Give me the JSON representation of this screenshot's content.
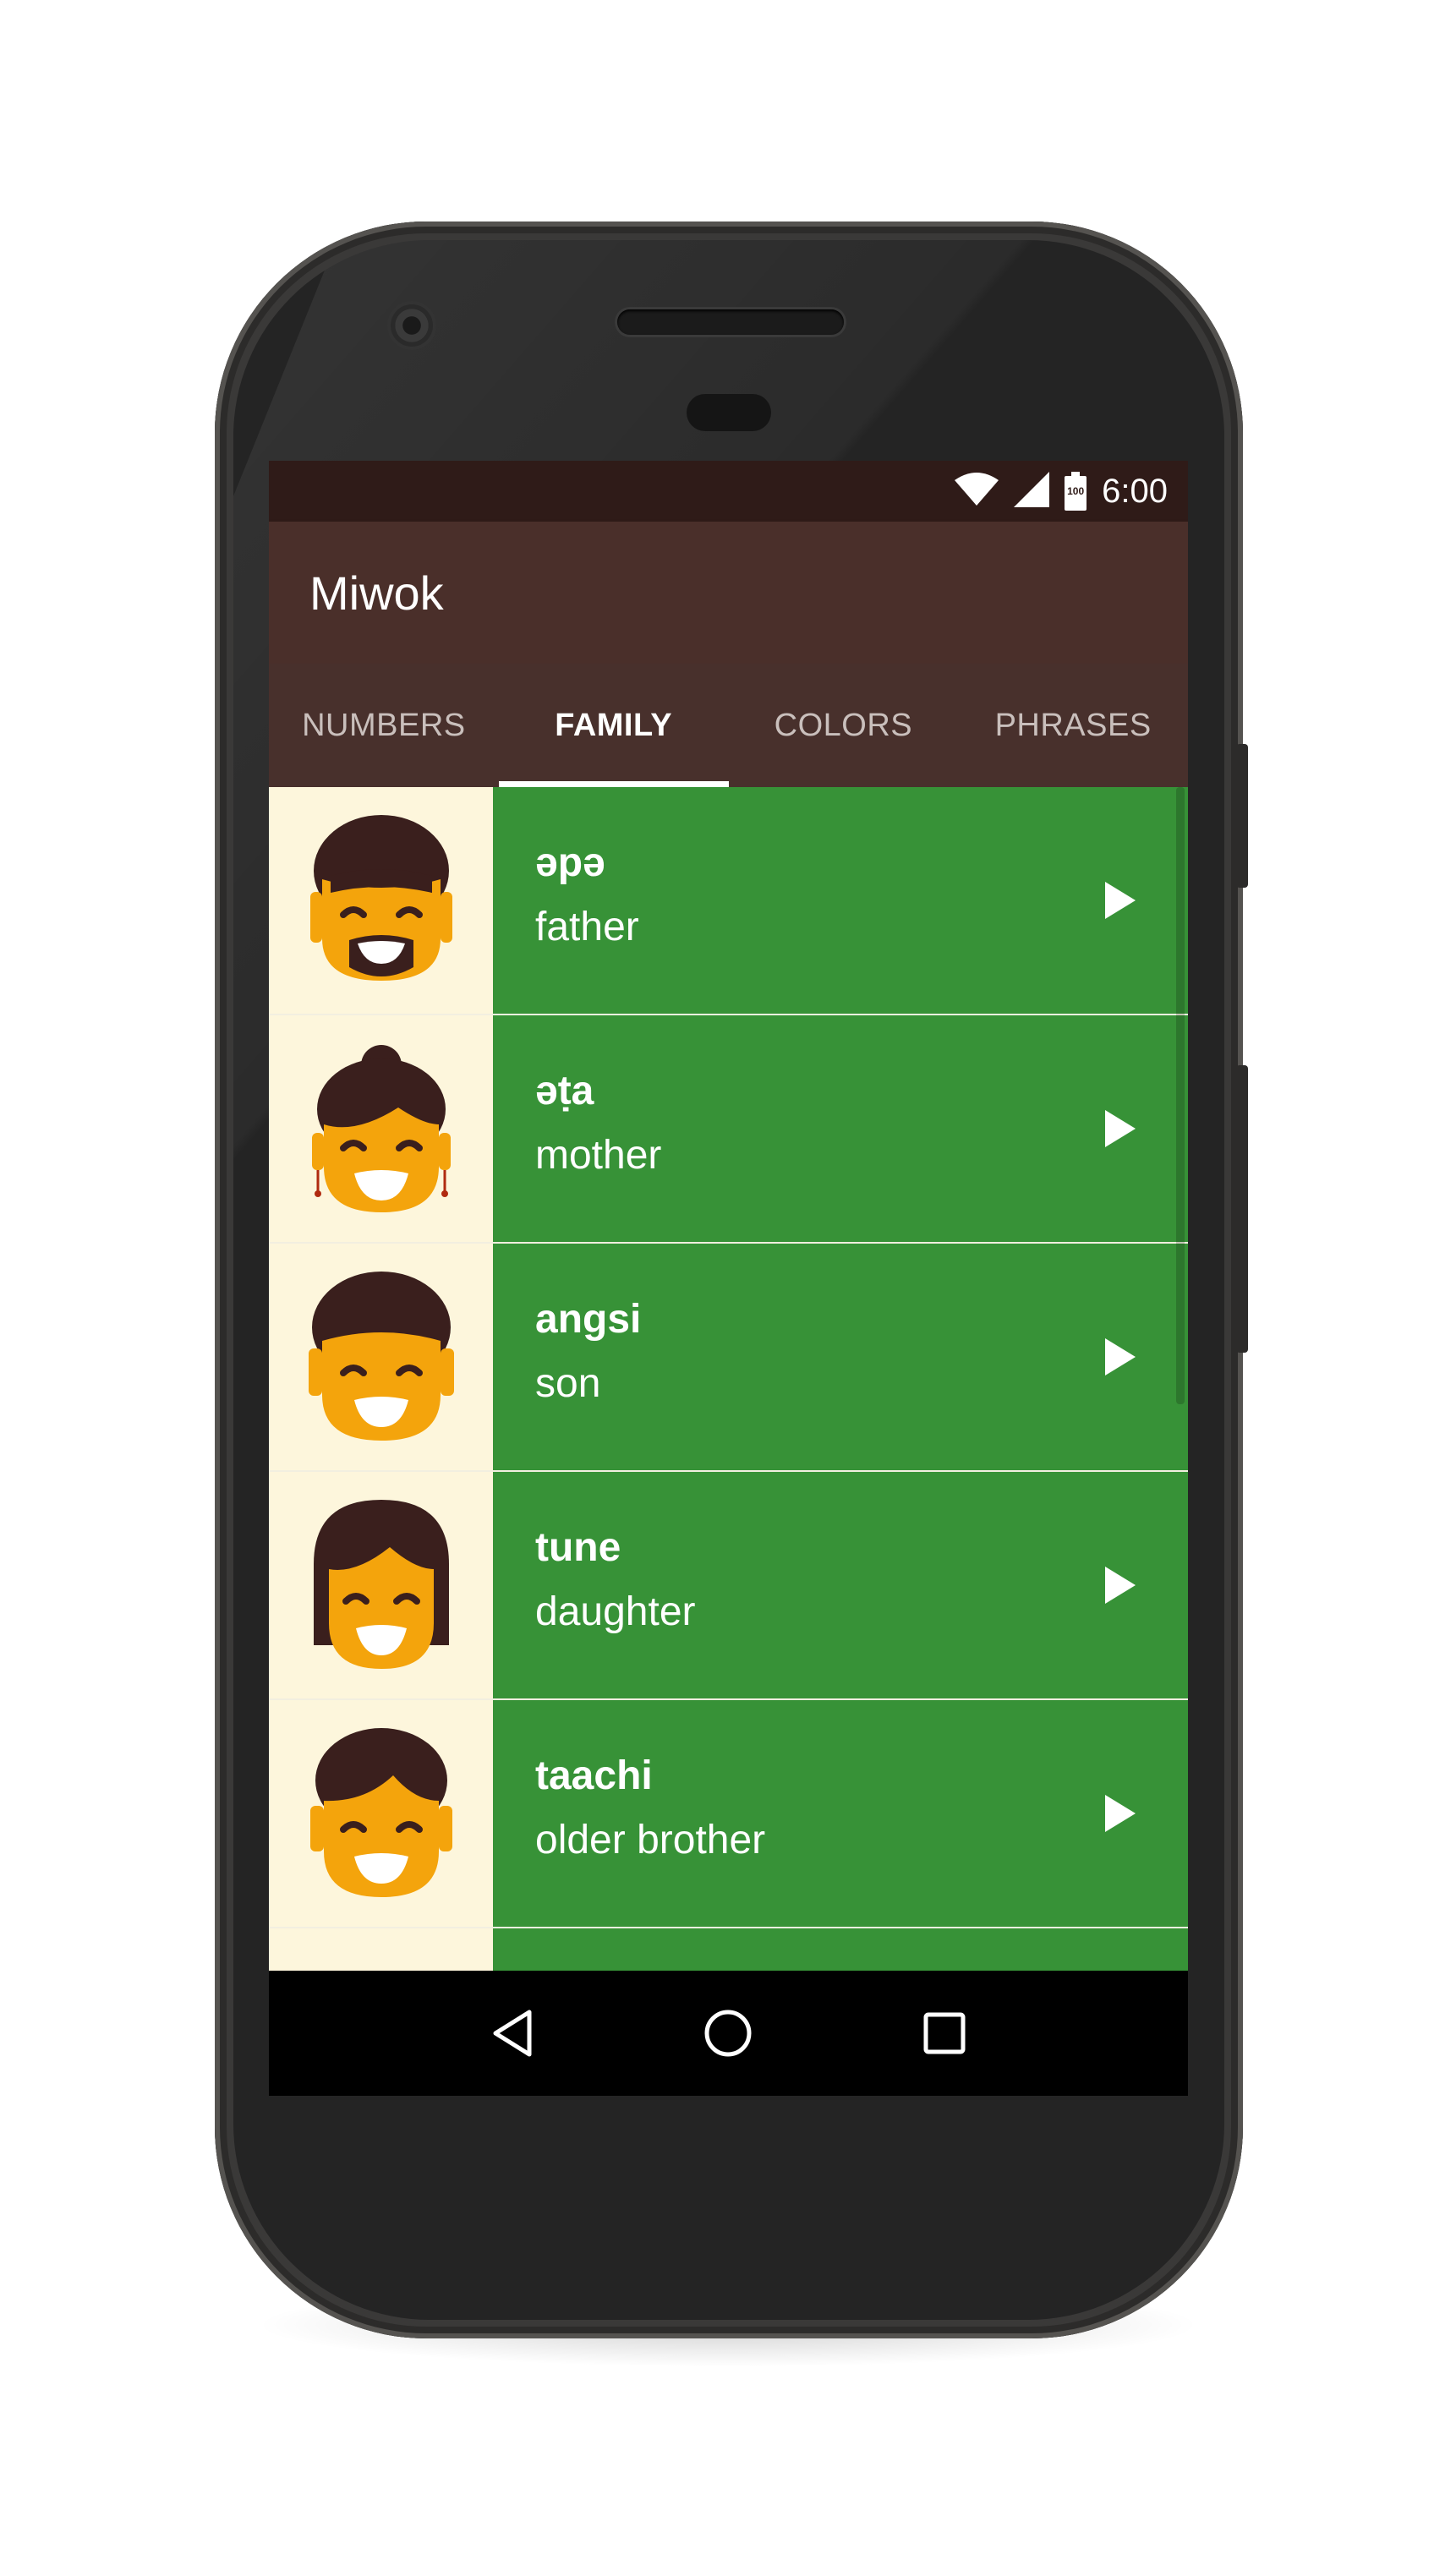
{
  "status_bar": {
    "time": "6:00",
    "battery_level": "100"
  },
  "app": {
    "title": "Miwok"
  },
  "tabs": [
    {
      "label": "NUMBERS",
      "active": false
    },
    {
      "label": "FAMILY",
      "active": true
    },
    {
      "label": "COLORS",
      "active": false
    },
    {
      "label": "PHRASES",
      "active": false
    }
  ],
  "family_list": [
    {
      "miwok": "əpə",
      "english": "father",
      "avatar": "father-avatar-icon"
    },
    {
      "miwok": "əṭa",
      "english": "mother",
      "avatar": "mother-avatar-icon"
    },
    {
      "miwok": "angsi",
      "english": "son",
      "avatar": "son-avatar-icon"
    },
    {
      "miwok": "tune",
      "english": "daughter",
      "avatar": "daughter-avatar-icon"
    },
    {
      "miwok": "taachi",
      "english": "older brother",
      "avatar": "older-brother-avatar-icon"
    }
  ],
  "colors": {
    "primary": "#4a2f2a",
    "primary_dark": "#2f1b18",
    "category_family": "#379237",
    "image_background": "#fdf6dc",
    "skin": "#f4a40c",
    "hair": "#3a1f1d"
  },
  "nav_bar": {
    "icons": [
      "back-icon",
      "home-icon",
      "recents-icon"
    ]
  }
}
